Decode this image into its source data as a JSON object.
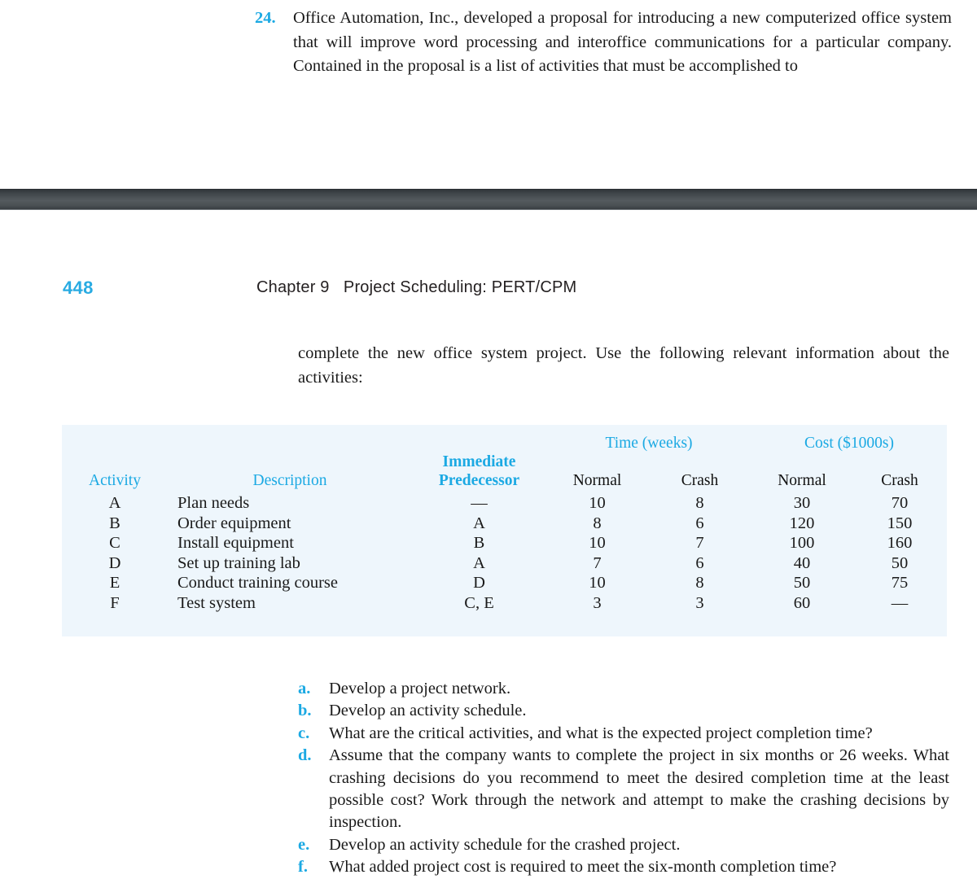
{
  "top_problem": {
    "number": "24.",
    "text": "Office Automation, Inc., developed a proposal for introducing a new computerized office system that will improve word processing and interoffice communications for a particular company. Contained in the proposal is a list of activities that must be accomplished to"
  },
  "running_head": {
    "folio": "448",
    "chapter_title": "Chapter 9   Project Scheduling: PERT/CPM"
  },
  "continuation_paragraph": "complete the new office system project. Use the following relevant information about the activities:",
  "table": {
    "group_headers": {
      "time": "Time (weeks)",
      "cost": "Cost ($1000s)"
    },
    "columns": {
      "activity": "Activity",
      "description": "Description",
      "immediate_predecessor_line1": "Immediate",
      "immediate_predecessor_line2": "Predecessor",
      "time_normal": "Normal",
      "time_crash": "Crash",
      "cost_normal": "Normal",
      "cost_crash": "Crash"
    },
    "rows": [
      {
        "activity": "A",
        "description": "Plan needs",
        "predecessor": "—",
        "time_normal": "10",
        "time_crash": "8",
        "cost_normal": "30",
        "cost_crash": "70"
      },
      {
        "activity": "B",
        "description": "Order equipment",
        "predecessor": "A",
        "time_normal": "8",
        "time_crash": "6",
        "cost_normal": "120",
        "cost_crash": "150"
      },
      {
        "activity": "C",
        "description": "Install equipment",
        "predecessor": "B",
        "time_normal": "10",
        "time_crash": "7",
        "cost_normal": "100",
        "cost_crash": "160"
      },
      {
        "activity": "D",
        "description": "Set up training lab",
        "predecessor": "A",
        "time_normal": "7",
        "time_crash": "6",
        "cost_normal": "40",
        "cost_crash": "50"
      },
      {
        "activity": "E",
        "description": "Conduct training course",
        "predecessor": "D",
        "time_normal": "10",
        "time_crash": "8",
        "cost_normal": "50",
        "cost_crash": "75"
      },
      {
        "activity": "F",
        "description": "Test system",
        "predecessor": "C, E",
        "time_normal": "3",
        "time_crash": "3",
        "cost_normal": "60",
        "cost_crash": "—"
      }
    ]
  },
  "sub_questions": [
    {
      "letter": "a.",
      "text": "Develop a project network."
    },
    {
      "letter": "b.",
      "text": "Develop an activity schedule."
    },
    {
      "letter": "c.",
      "text": "What are the critical activities, and what is the expected project completion time?"
    },
    {
      "letter": "d.",
      "text": "Assume that the company wants to complete the project in six months or 26 weeks. What crashing decisions do you recommend to meet the desired completion time at the least possible cost? Work through the network and attempt to make the crashing decisions by inspection."
    },
    {
      "letter": "e.",
      "text": "Develop an activity schedule for the crashed project."
    },
    {
      "letter": "f.",
      "text": "What added project cost is required to meet the six-month completion time?"
    }
  ],
  "colors": {
    "accent_cyan": "#1BA9E3",
    "folio_cyan": "#29ABE2",
    "table_background": "#eef6fc",
    "body_text": "#1a1a1a",
    "separator_bar": "#4a5053"
  }
}
